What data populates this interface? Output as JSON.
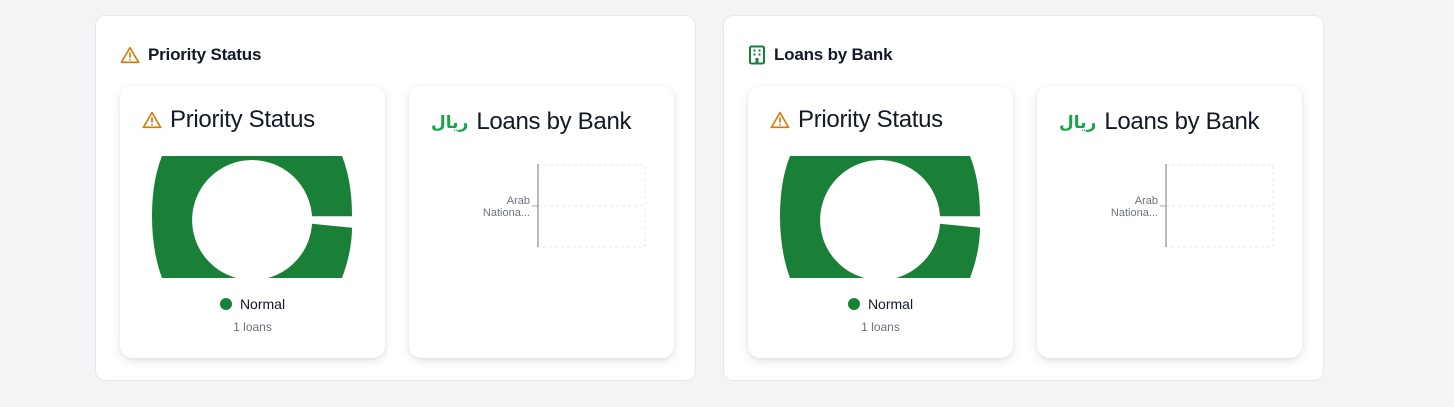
{
  "panels": [
    {
      "title": "Priority Status",
      "header_icon": "warning-triangle-icon",
      "priority_card": {
        "title": "Priority Status",
        "icon": "warning-triangle-icon",
        "legend_label": "Normal",
        "legend_count": "1 loans"
      },
      "bank_card": {
        "title": "Loans by Bank",
        "currency_symbol": "ريال",
        "bank_tick_line1": "Arab",
        "bank_tick_line2": "Nationa..."
      }
    },
    {
      "title": "Loans by Bank",
      "header_icon": "building-icon",
      "priority_card": {
        "title": "Priority Status",
        "icon": "warning-triangle-icon",
        "legend_label": "Normal",
        "legend_count": "1 loans"
      },
      "bank_card": {
        "title": "Loans by Bank",
        "currency_symbol": "ريال",
        "bank_tick_line1": "Arab",
        "bank_tick_line2": "Nationa..."
      }
    }
  ],
  "colors": {
    "normal_status": "#1a7f37",
    "warning_icon": "#d97706",
    "building_icon": "#15803d",
    "riyal": "#16a34a"
  }
}
